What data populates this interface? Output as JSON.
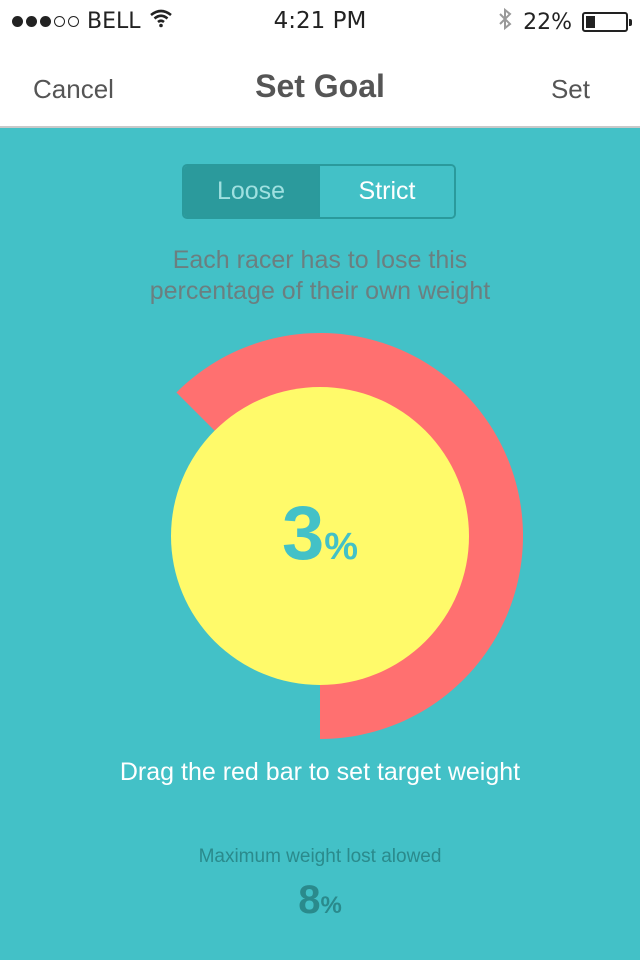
{
  "status_bar": {
    "carrier": "BELL",
    "signal_dots_full": 3,
    "signal_dots_empty": 2,
    "time": "4:21 PM",
    "battery_percent": "22%",
    "icons": [
      "wifi-icon",
      "bluetooth-icon",
      "battery-icon"
    ]
  },
  "nav": {
    "cancel_label": "Cancel",
    "title": "Set Goal",
    "set_label": "Set"
  },
  "segmented": {
    "options": [
      "Loose",
      "Strict"
    ],
    "selected": "Loose"
  },
  "instruction": {
    "line1": "Each racer has to lose this",
    "line2": "percentage of their own weight"
  },
  "dial": {
    "value": "3",
    "unit": "%",
    "fill_fraction": 0.375
  },
  "drag_hint": "Drag the red bar to set target weight",
  "max": {
    "label": "Maximum weight lost alowed",
    "value": "8",
    "unit": "%"
  },
  "colors": {
    "background": "#43c1c7",
    "ring": "#ff7070",
    "center": "#fffa6a",
    "accent_dark": "#2a8a8c"
  }
}
